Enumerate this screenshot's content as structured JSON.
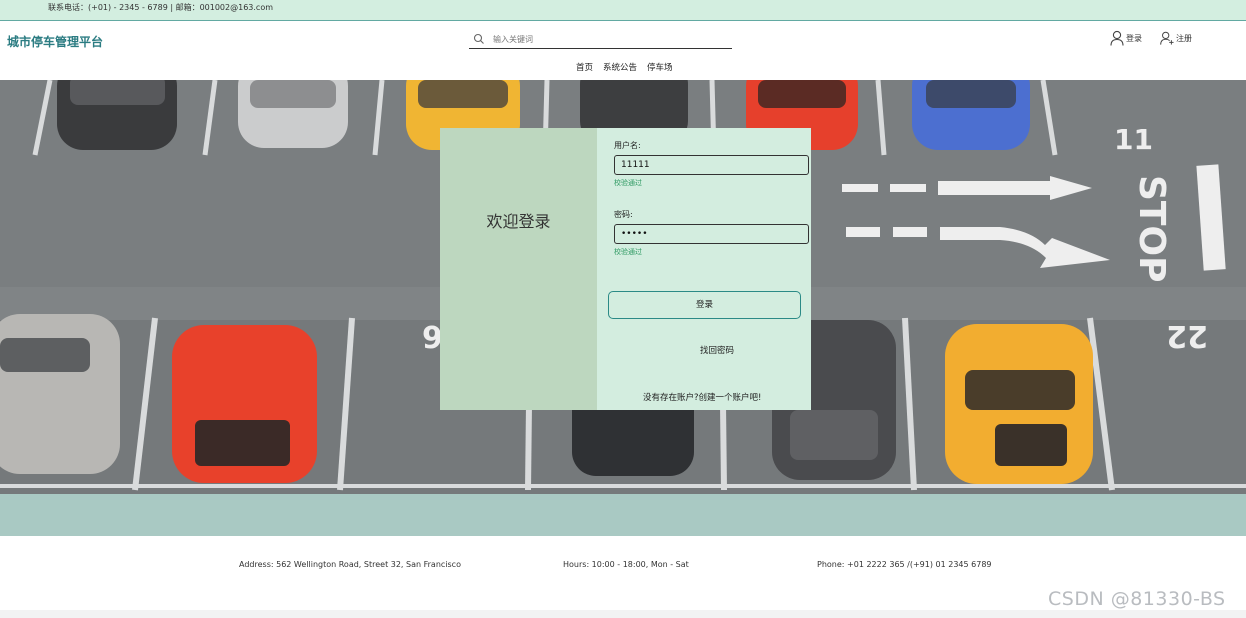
{
  "topbar": {
    "contact": "联系电话：(+01) - 2345 - 6789 | 邮箱：001002@163.com"
  },
  "header": {
    "brand": "城市停车管理平台",
    "search_placeholder": "输入关键词",
    "login_label": "登录",
    "register_label": "注册"
  },
  "nav": {
    "items": [
      "首页",
      "系统公告",
      "停车场"
    ]
  },
  "login_form": {
    "welcome": "欢迎登录",
    "username_label": "用户名:",
    "username_value": "11111",
    "username_status": "校验通过",
    "password_label": "密码:",
    "password_value": "•••••",
    "password_status": "校验通过",
    "submit_label": "登录",
    "forgot_label": "找回密码",
    "register_prompt": "没有存在账户?创建一个账户吧!"
  },
  "hero": {
    "road_markings": [
      "11",
      "STOP",
      "9",
      "22"
    ]
  },
  "footer": {
    "address": "Address: 562 Wellington Road, Street 32, San Francisco",
    "hours": "Hours: 10:00 - 18:00, Mon - Sat",
    "phone": "Phone: +01 2222 365 /(+91) 01 2345 6789"
  },
  "watermark": "CSDN @81330-BS",
  "colors": {
    "brand": "#2b7c82",
    "topbar_bg": "#d3eee0",
    "panel_bg": "#d3eddf",
    "panel_left_bg": "#bdd7bf",
    "valid_text": "#2f9a63",
    "band_bg": "#a9c9c3"
  }
}
